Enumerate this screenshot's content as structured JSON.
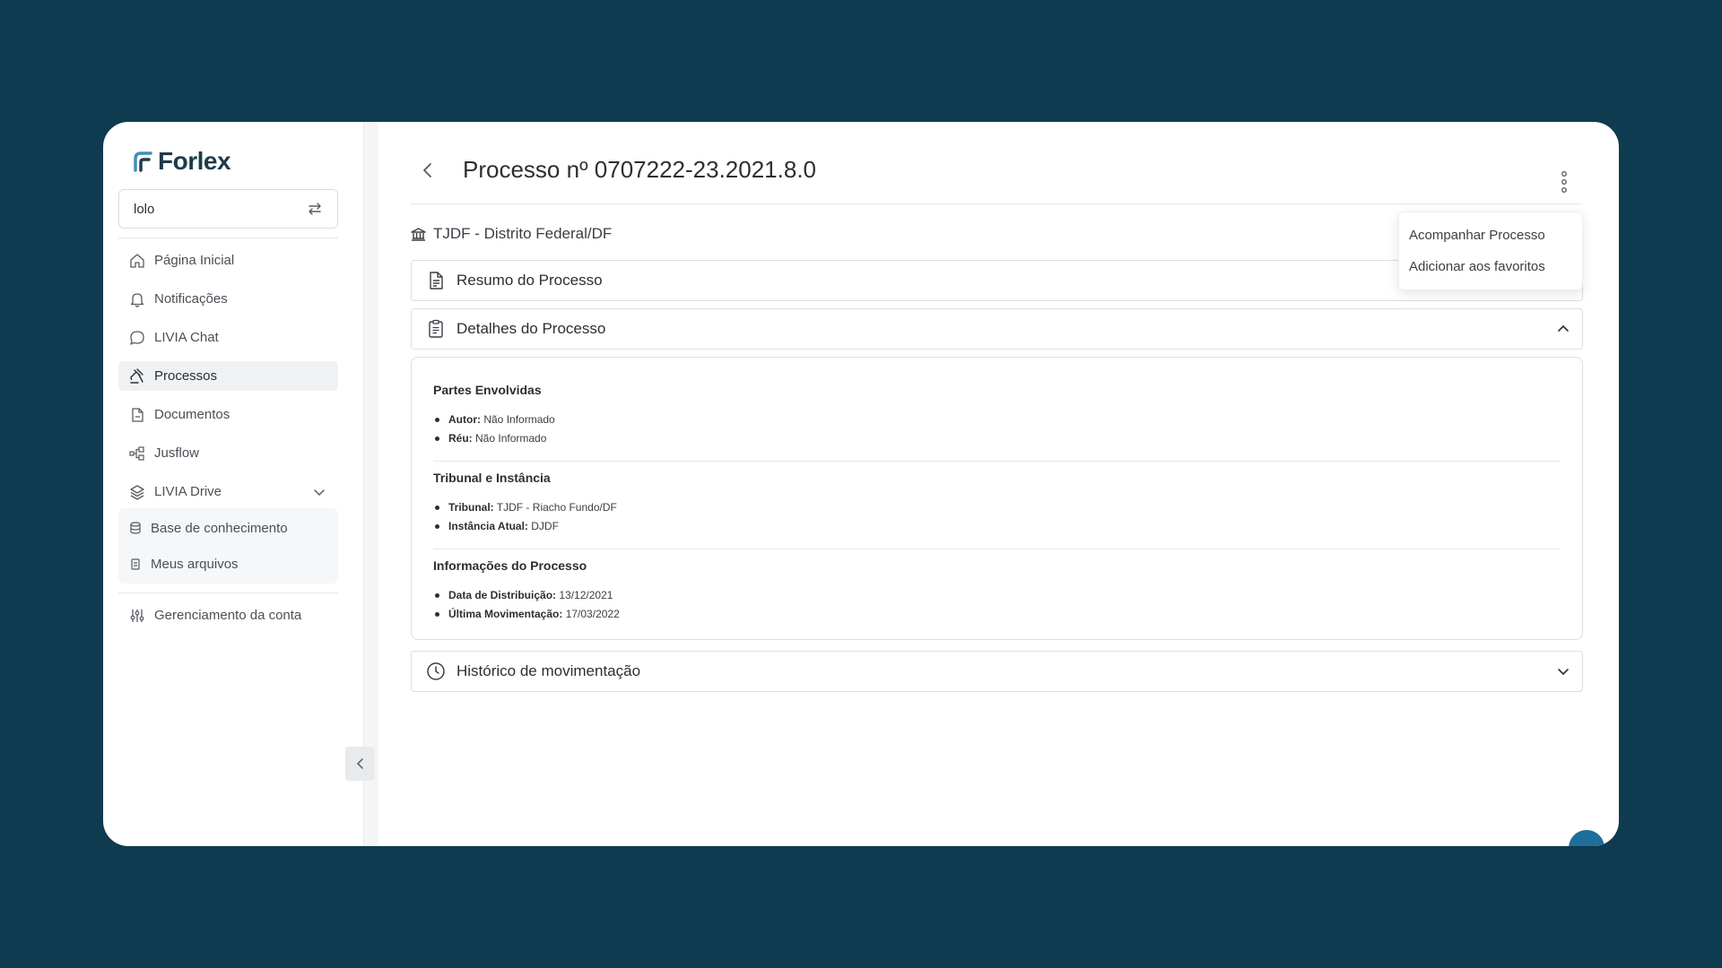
{
  "app": {
    "logo_text": "Forlex",
    "brand_color": "#1d3b4c",
    "accent_color": "#3f8fb5"
  },
  "workspace": {
    "name": "lolo"
  },
  "sidebar": {
    "items": [
      {
        "label": "Página Inicial",
        "icon": "home-icon"
      },
      {
        "label": "Notificações",
        "icon": "bell-icon"
      },
      {
        "label": "LIVIA Chat",
        "icon": "chat-icon"
      },
      {
        "label": "Processos",
        "icon": "gavel-icon",
        "active": true
      },
      {
        "label": "Documentos",
        "icon": "document-icon"
      },
      {
        "label": "Jusflow",
        "icon": "flow-icon"
      },
      {
        "label": "LIVIA Drive",
        "icon": "layers-icon"
      }
    ],
    "drive_subitems": [
      {
        "label": "Base de conhecimento",
        "icon": "database-icon"
      },
      {
        "label": "Meus arquivos",
        "icon": "files-icon"
      }
    ],
    "account": {
      "label": "Gerenciamento da conta",
      "icon": "sliders-icon"
    }
  },
  "header": {
    "title": "Processo nº 0707222-23.2021.8.0"
  },
  "court": {
    "label": "TJDF - Distrito Federal/DF"
  },
  "menu": {
    "items": [
      "Acompanhar Processo",
      "Adicionar aos favoritos"
    ]
  },
  "accordions": {
    "resumo": "Resumo do Processo",
    "detalhes": "Detalhes do Processo",
    "historico": "Histórico de movimentação"
  },
  "details": {
    "partes": {
      "title": "Partes Envolvidas",
      "items": [
        {
          "label": "Autor:",
          "value": "Não Informado"
        },
        {
          "label": "Réu:",
          "value": "Não Informado"
        }
      ]
    },
    "tribunal": {
      "title": "Tribunal e Instância",
      "items": [
        {
          "label": "Tribunal:",
          "value": "TJDF - Riacho Fundo/DF"
        },
        {
          "label": "Instância Atual:",
          "value": "DJDF"
        }
      ]
    },
    "info": {
      "title": "Informações do Processo",
      "items": [
        {
          "label": "Data de Distribuição:",
          "value": "13/12/2021"
        },
        {
          "label": "Última Movimentação:",
          "value": "17/03/2022"
        }
      ]
    }
  }
}
